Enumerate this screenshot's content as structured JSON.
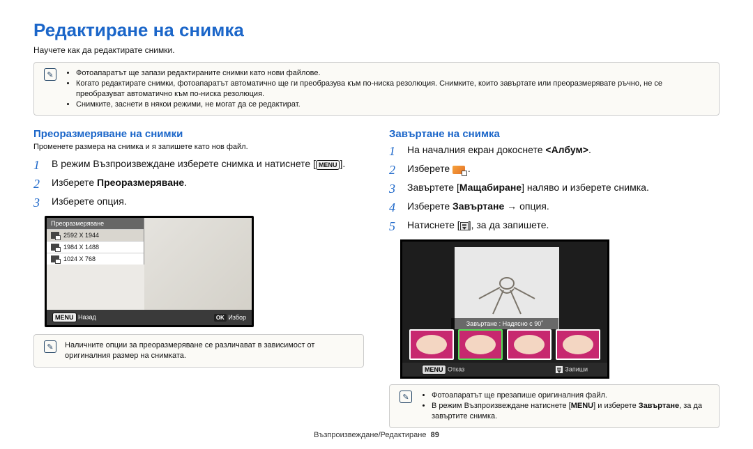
{
  "title": "Редактиране на снимка",
  "subtitle": "Научете как да редактирате снимки.",
  "top_notes": [
    "Фотоапаратът ще запази редактираните снимки като нови файлове.",
    "Когато редактирате снимки, фотоапаратът автоматично ще ги преобразува към по-ниска резолюция. Снимките, които завъртате или преоразмерявате ръчно, не се преобразуват автоматично към по-ниска резолюция.",
    "Снимките, заснети в някои режими, не могат да се редактират."
  ],
  "left": {
    "heading": "Преоразмеряване на снимки",
    "desc": "Променете размера на снимка и я запишете като нов файл.",
    "steps": {
      "s1a": "В режим Възпроизвеждане изберете снимка и натиснете [",
      "s1b": "].",
      "s2a": "Изберете ",
      "s2b": "Преоразмеряване",
      "s2c": ".",
      "s3": "Изберете опция."
    },
    "screen": {
      "header": "Преоразмеряване",
      "opts": [
        "2592 X 1944",
        "1984 X 1488",
        "1024 X 768"
      ],
      "back": "Назад",
      "select": "Избор",
      "menu": "MENU",
      "ok": "OK"
    },
    "note": "Наличните опции за преоразмеряване се различават в зависимост от оригиналния размер на снимката."
  },
  "right": {
    "heading": "Завъртане на снимка",
    "steps": {
      "s1a": "На началния екран докоснете ",
      "s1b": "<Албум>",
      "s1c": ".",
      "s2": "Изберете ",
      "s3a": "Завъртете [",
      "s3b": "Мащабиране",
      "s3c": "] наляво и изберете снимка.",
      "s4a": "Изберете ",
      "s4b": "Завъртане",
      "s4c": " → опция.",
      "s5a": "Натиснете [",
      "s5b": "], за да запишете."
    },
    "screen": {
      "overlay": "Завъртане : Надясно с 90˚",
      "cancel": "Отказ",
      "save": "Запиши",
      "menu": "MENU"
    },
    "notes": [
      "Фотоапаратът ще презапише оригиналния файл.",
      "В режим Възпроизвеждане натиснете [<b>MENU</b>] и изберете <b>Завъртане</b>, за да завъртите снимка."
    ]
  },
  "footer": {
    "section": "Възпроизвеждане/Редактиране",
    "page": "89"
  }
}
